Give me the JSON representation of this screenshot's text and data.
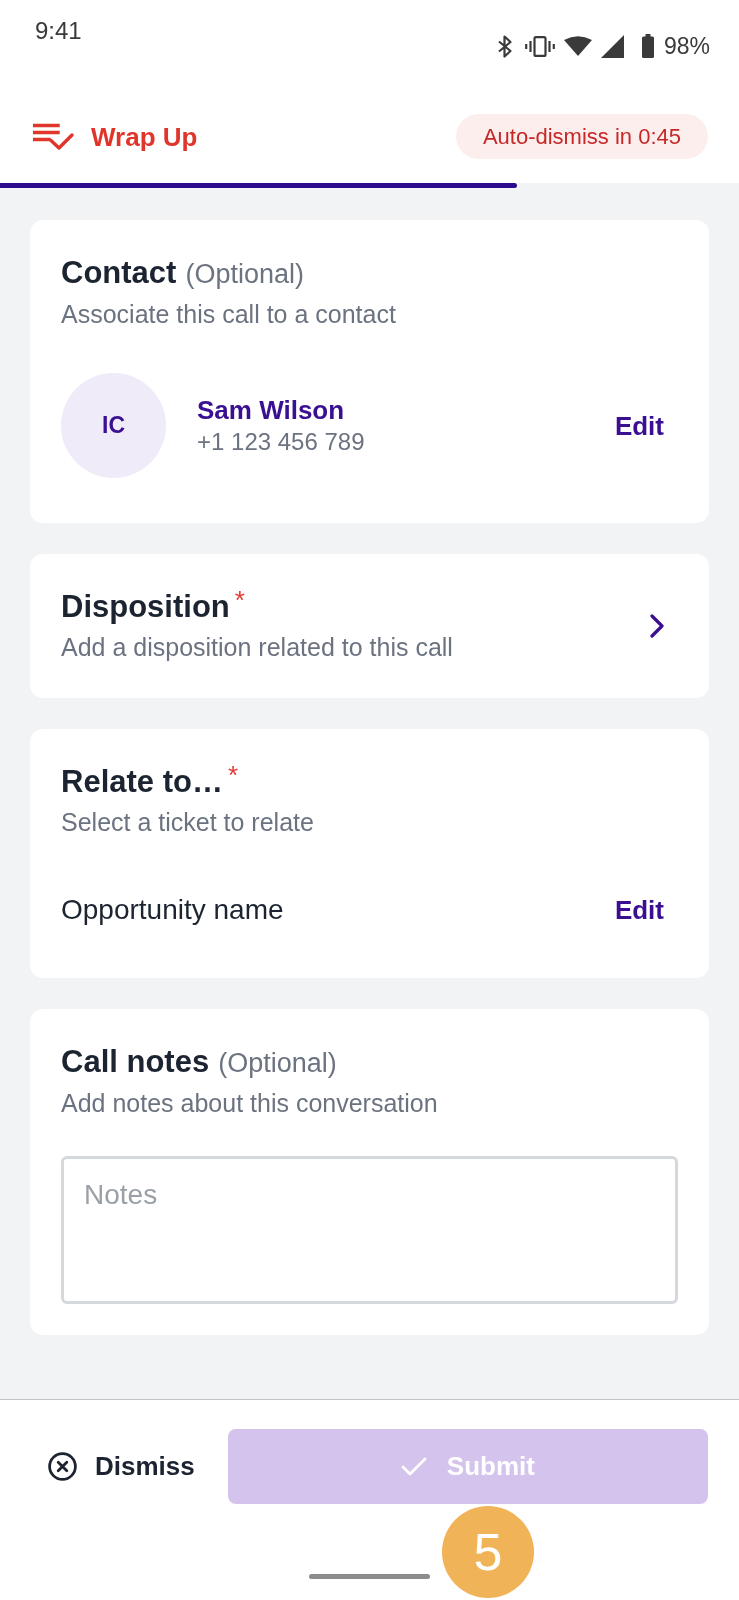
{
  "status_bar": {
    "time": "9:41",
    "battery": "98%"
  },
  "header": {
    "title": "Wrap Up",
    "auto_dismiss": "Auto-dismiss in 0:45"
  },
  "progress": {
    "level": 0.7
  },
  "sections": [
    {
      "kind": "contact",
      "title": "Contact",
      "optional_label": "(Optional)",
      "subtitle": "Associate this call to a contact",
      "contact": {
        "initials": "IC",
        "name": "Sam Wilson",
        "phone": "+1 123 456 789"
      },
      "action": "Edit"
    },
    {
      "kind": "picker",
      "title": "Disposition",
      "required_mark": "*",
      "subtitle": "Add a disposition related to this call"
    },
    {
      "kind": "relation",
      "title": "Relate to…",
      "required_mark": "*",
      "subtitle": "Select a ticket to relate",
      "item": "Opportunity name",
      "action": "Edit"
    },
    {
      "kind": "notes",
      "title": "Call notes",
      "optional_label": "(Optional)",
      "subtitle": "Add notes about this conversation",
      "notes": {
        "placeholder": "Notes"
      }
    }
  ],
  "footer": {
    "dismiss": "Dismiss",
    "submit": {
      "label": "Submit",
      "disabled": true
    }
  },
  "step_marker": "5"
}
